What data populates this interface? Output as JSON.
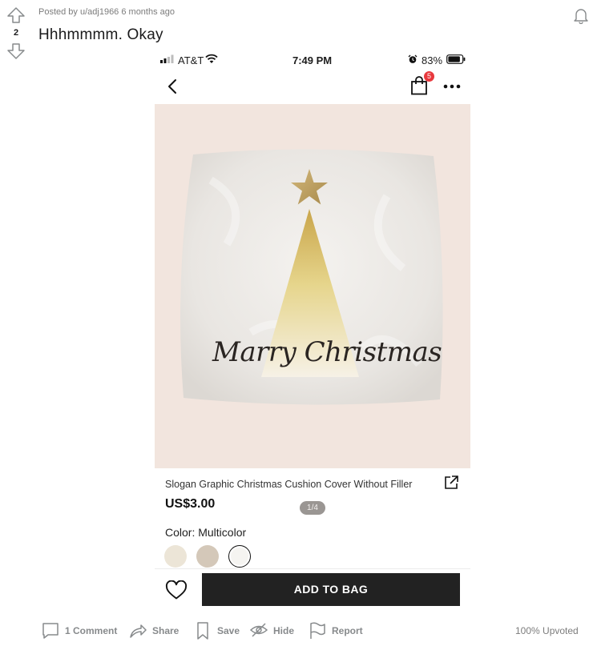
{
  "post": {
    "score": "2",
    "meta": "Posted by u/adj1966 6 months ago",
    "title": "Hhhmmmm. Okay",
    "upvote_ratio": "100% Upvoted"
  },
  "icons": {
    "upvote": "arrow-up-icon",
    "downvote": "arrow-down-icon",
    "notifications": "bell-icon"
  },
  "phone": {
    "status": {
      "carrier": "AT&T",
      "time": "7:49 PM",
      "battery": "83%"
    },
    "bag_count": "5",
    "product": {
      "image_text": "Marry Christmas",
      "image_counter": "1/4",
      "name": "Slogan Graphic Christmas Cushion Cover Without Filler",
      "price": "US$3.00",
      "color_label": "Color: Multicolor",
      "swatch_colors": [
        "#ece5d7",
        "#d4c8b9",
        "#f5f4f1"
      ]
    },
    "add_to_bag": "ADD TO BAG",
    "accent": "#222222",
    "badge_color": "#e8383d"
  },
  "actions": {
    "comment": "1 Comment",
    "share": "Share",
    "save": "Save",
    "hide": "Hide",
    "report": "Report"
  }
}
